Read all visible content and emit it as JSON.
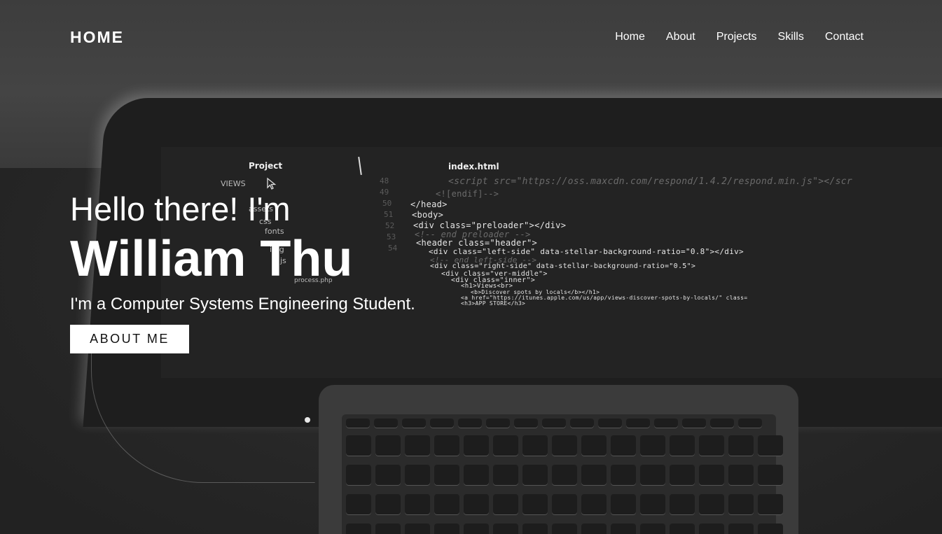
{
  "nav": {
    "brand": "HOME",
    "items": [
      {
        "label": "Home"
      },
      {
        "label": "About"
      },
      {
        "label": "Projects"
      },
      {
        "label": "Skills"
      },
      {
        "label": "Contact"
      }
    ]
  },
  "hero": {
    "greeting": "Hello there! I'm",
    "name": "William Thu",
    "tagline": "I'm a Computer Systems Engineering Student.",
    "button_label": "ABOUT ME"
  },
  "background": {
    "panel_title": "Project",
    "file_tab": "index.html",
    "tree": [
      "VIEWS",
      "assets",
      "css",
      "fonts",
      "img",
      "js",
      "process.php"
    ],
    "code": [
      "<script src=\"https://oss.maxcdn.com/respond/1.4.2/respond.min.js\"></scr",
      "<![endif]-->",
      "</head>",
      "<body>",
      "<div class=\"preloader\"></div>",
      "<!-- end preloader -->",
      "<header class=\"header\">",
      "<div class=\"left-side\" data-stellar-background-ratio=\"0.8\"></div>",
      "<!-- end left-side -->",
      "<div class=\"right-side\" data-stellar-background-ratio=\"0.5\">",
      "<div class=\"ver-middle\">",
      "<div class=\"inner\">",
      "<h1>Views<br>",
      "<b>Discover spots by locals</b></h1>",
      "<a href=\"https://itunes.apple.com/us/app/views-discover-spots-by-locals/\" class=",
      "<h3>APP STORE</h3>"
    ],
    "line_numbers": [
      "48",
      "49",
      "50",
      "51",
      "52",
      "53",
      "54"
    ]
  }
}
